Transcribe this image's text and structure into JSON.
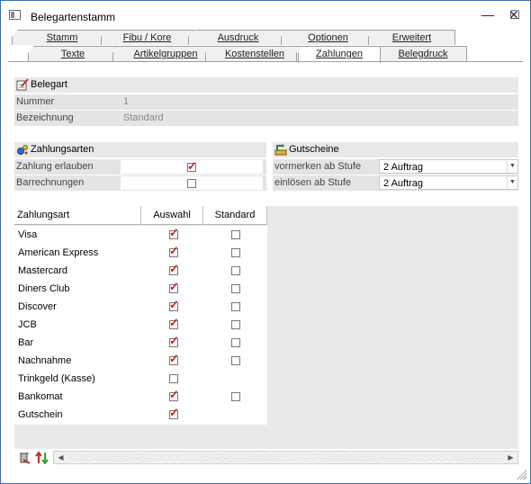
{
  "window": {
    "title": "Belegartenstamm",
    "minimize": "—",
    "maximize": "☐",
    "close": "✕"
  },
  "tabs_top": [
    "Stamm",
    "Fibu / Kore",
    "Ausdruck",
    "Optionen",
    "Erweitert"
  ],
  "tabs_bottom": [
    "Texte",
    "Artikelgruppen",
    "Kostenstellen",
    "Zahlungen",
    "Belegdruck"
  ],
  "active_tab": "Zahlungen",
  "belegart": {
    "header": "Belegart",
    "nummer_label": "Nummer",
    "nummer_value": "1",
    "bezeichnung_label": "Bezeichnung",
    "bezeichnung_value": "Standard"
  },
  "zahlungsarten": {
    "header": "Zahlungsarten",
    "erlauben_label": "Zahlung erlauben",
    "erlauben_checked": true,
    "barrechnungen_label": "Barrechnungen",
    "barrechnungen_checked": false
  },
  "gutscheine": {
    "header": "Gutscheine",
    "vormerken_label": "vormerken ab Stufe",
    "vormerken_value": "2 Auftrag",
    "einloesen_label": "einlösen ab Stufe",
    "einloesen_value": "2 Auftrag"
  },
  "grid": {
    "columns": [
      "Zahlungsart",
      "Auswahl",
      "Standard"
    ],
    "rows": [
      {
        "name": "Visa",
        "auswahl": true,
        "standard": false,
        "has_standard": true
      },
      {
        "name": "American Express",
        "auswahl": true,
        "standard": false,
        "has_standard": true
      },
      {
        "name": "Mastercard",
        "auswahl": true,
        "standard": false,
        "has_standard": true
      },
      {
        "name": "Diners Club",
        "auswahl": true,
        "standard": false,
        "has_standard": true
      },
      {
        "name": "Discover",
        "auswahl": true,
        "standard": false,
        "has_standard": true
      },
      {
        "name": "JCB",
        "auswahl": true,
        "standard": false,
        "has_standard": true
      },
      {
        "name": "Bar",
        "auswahl": true,
        "standard": false,
        "has_standard": true
      },
      {
        "name": "Nachnahme",
        "auswahl": true,
        "standard": false,
        "has_standard": true
      },
      {
        "name": "Trinkgeld (Kasse)",
        "auswahl": false,
        "standard": false,
        "has_standard": false
      },
      {
        "name": "Bankomat",
        "auswahl": true,
        "standard": false,
        "has_standard": true
      },
      {
        "name": "Gutschein",
        "auswahl": true,
        "standard": false,
        "has_standard": false
      }
    ]
  },
  "icons": {
    "belegart": "pencil-document-icon",
    "zahlungsarten": "coins-icon",
    "gutscheine": "voucher-icon",
    "delete": "delete-row-icon",
    "sort": "sort-icon",
    "check_color": "#d21b1b"
  }
}
